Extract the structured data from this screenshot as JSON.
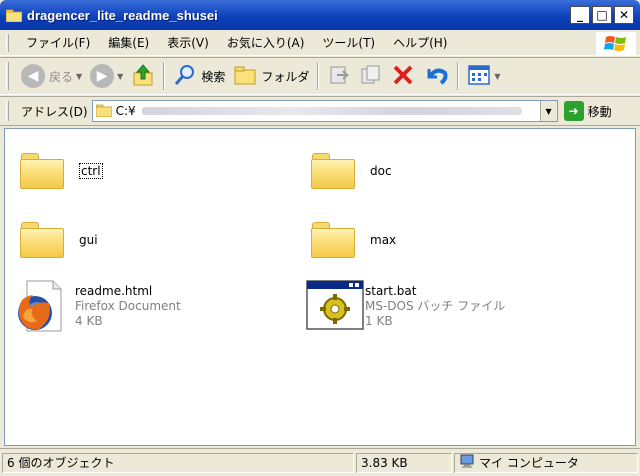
{
  "window": {
    "title": "dragencer_lite_readme_shusei"
  },
  "menu": [
    "ファイル(F)",
    "編集(E)",
    "表示(V)",
    "お気に入り(A)",
    "ツール(T)",
    "ヘルプ(H)"
  ],
  "toolbar": {
    "back_label": "戻る",
    "search_label": "検索",
    "folders_label": "フォルダ"
  },
  "address": {
    "label": "アドレス(D)",
    "path": "C:¥",
    "go_label": "移動"
  },
  "items": [
    {
      "name": "ctrl",
      "type": "folder"
    },
    {
      "name": "doc",
      "type": "folder"
    },
    {
      "name": "gui",
      "type": "folder"
    },
    {
      "name": "max",
      "type": "folder"
    },
    {
      "name": "readme.html",
      "type": "Firefox Document",
      "size": "4 KB"
    },
    {
      "name": "start.bat",
      "type": "MS-DOS バッチ ファイル",
      "size": "1 KB"
    }
  ],
  "status": {
    "count": "6 個のオブジェクト",
    "size": "3.83 KB",
    "location": "マイ コンピュータ"
  },
  "colors": {
    "titlebar": "#0a3fb8",
    "folder": "#f3c94a",
    "go": "#2da12d",
    "delete": "#e02020",
    "undo": "#1a6fd8"
  }
}
